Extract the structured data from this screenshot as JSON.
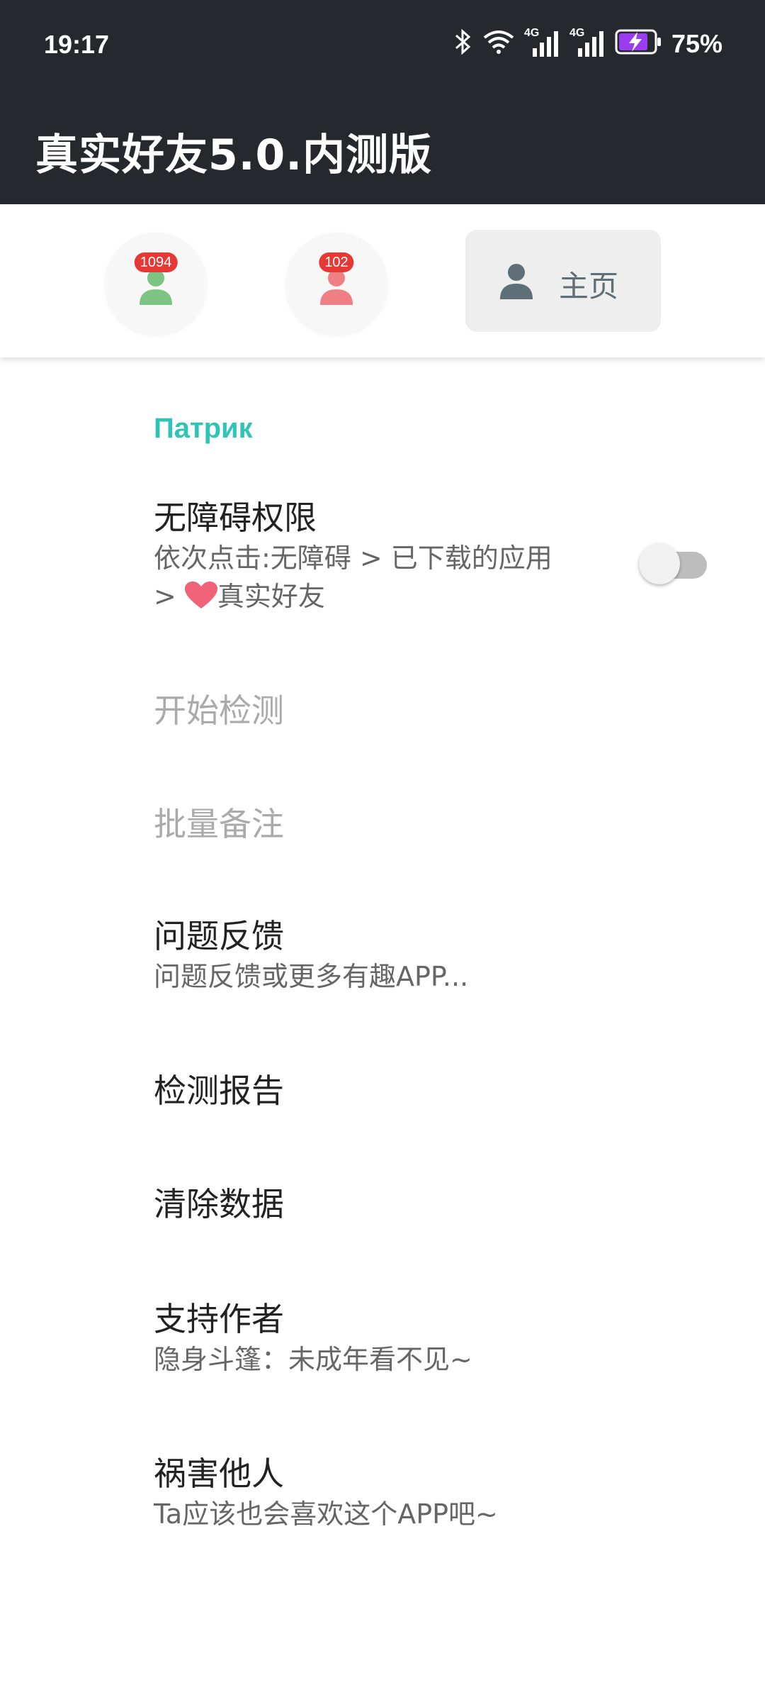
{
  "status_bar": {
    "time": "19:17",
    "battery_percent": "75%",
    "icons": [
      "bluetooth-icon",
      "wifi-icon",
      "signal-4g-icon",
      "signal-4g-icon",
      "battery-charging-icon"
    ],
    "network_label_1": "4G",
    "network_label_2": "4G"
  },
  "app_bar": {
    "title": "真实好友5.0.内测版"
  },
  "tabs": [
    {
      "icon": "person-icon",
      "badge": "1094",
      "color": "#7dc383"
    },
    {
      "icon": "person-icon",
      "badge": "102",
      "color": "#ef7f84"
    },
    {
      "icon": "person-icon",
      "label": "主页",
      "color": "#5f6f78",
      "selected": true
    }
  ],
  "settings": {
    "section_header": "Патрик",
    "accessibility": {
      "title": "无障碍权限",
      "summary_line1": "依次点击:无障碍 > 已下载的应用",
      "summary_line2_prefix": "> ",
      "summary_line2_suffix": "真实好友",
      "switch_on": false
    },
    "start_detect": {
      "title": "开始检测",
      "enabled": false
    },
    "batch_remark": {
      "title": "批量备注",
      "enabled": false
    },
    "feedback": {
      "title": "问题反馈",
      "summary": "问题反馈或更多有趣APP..."
    },
    "report": {
      "title": "检测报告"
    },
    "clear_data": {
      "title": "清除数据"
    },
    "support": {
      "title": "支持作者",
      "summary": "隐身斗篷：未成年看不见~"
    },
    "share": {
      "title": "祸害他人",
      "summary": "Ta应该也会喜欢这个APP吧~"
    }
  },
  "colors": {
    "app_bar": "#25282c",
    "accent": "#2ec4b6",
    "badge": "#e53935",
    "heart": "#f06277"
  }
}
